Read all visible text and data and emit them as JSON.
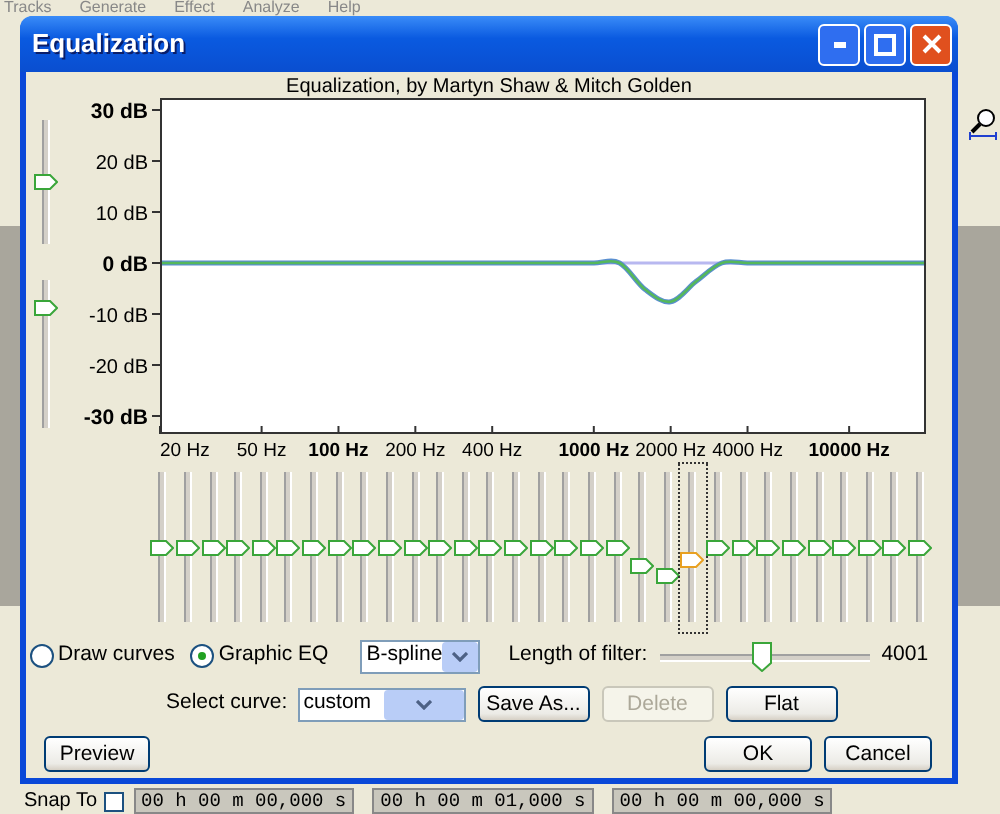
{
  "background_app": {
    "menu": [
      "Tracks",
      "Generate",
      "Effect",
      "Analyze",
      "Help"
    ],
    "snap_to": {
      "label": "Snap To",
      "checked": false
    },
    "time_fields": [
      "00 h 00 m 00,000 s",
      "00 h 00 m 01,000 s",
      "00 h 00 m 00,000 s"
    ]
  },
  "dialog": {
    "title": "Equalization",
    "header": "Equalization, by Martyn Shaw & Mitch Golden",
    "gain_sliders": [
      {
        "level": 0.5
      },
      {
        "level": 0.81
      }
    ],
    "graph": {
      "y_labels": [
        "30 dB",
        "20 dB",
        "10 dB",
        "0 dB",
        "-10 dB",
        "-20 dB",
        "-30 dB"
      ],
      "x_labels": [
        "20 Hz",
        "50 Hz",
        "100 Hz",
        "200 Hz",
        "400 Hz",
        "1000 Hz",
        "2000 Hz",
        "4000 Hz",
        "10000 Hz"
      ]
    },
    "bands": [
      {
        "level": 0.5,
        "selected": false
      },
      {
        "level": 0.5,
        "selected": false
      },
      {
        "level": 0.5,
        "selected": false
      },
      {
        "level": 0.5,
        "selected": false
      },
      {
        "level": 0.5,
        "selected": false
      },
      {
        "level": 0.5,
        "selected": false
      },
      {
        "level": 0.5,
        "selected": false
      },
      {
        "level": 0.5,
        "selected": false
      },
      {
        "level": 0.5,
        "selected": false
      },
      {
        "level": 0.5,
        "selected": false
      },
      {
        "level": 0.5,
        "selected": false
      },
      {
        "level": 0.5,
        "selected": false
      },
      {
        "level": 0.5,
        "selected": false
      },
      {
        "level": 0.5,
        "selected": false
      },
      {
        "level": 0.5,
        "selected": false
      },
      {
        "level": 0.5,
        "selected": false
      },
      {
        "level": 0.5,
        "selected": false
      },
      {
        "level": 0.5,
        "selected": false
      },
      {
        "level": 0.5,
        "selected": false
      },
      {
        "level": 0.37,
        "selected": false
      },
      {
        "level": 0.31,
        "selected": false
      },
      {
        "level": 0.41,
        "selected": true
      },
      {
        "level": 0.5,
        "selected": false
      },
      {
        "level": 0.5,
        "selected": false
      },
      {
        "level": 0.5,
        "selected": false
      },
      {
        "level": 0.5,
        "selected": false
      },
      {
        "level": 0.5,
        "selected": false
      },
      {
        "level": 0.5,
        "selected": false
      },
      {
        "level": 0.5,
        "selected": false
      },
      {
        "level": 0.5,
        "selected": false
      },
      {
        "level": 0.5,
        "selected": false
      }
    ],
    "mode_options": [
      {
        "label": "Draw curves",
        "selected": false
      },
      {
        "label": "Graphic EQ",
        "selected": true
      }
    ],
    "interpolation": "B-spline",
    "filter_length": {
      "label": "Length of filter:",
      "level": 0.49,
      "reading": "4001"
    },
    "curve": {
      "label": "Select curve:",
      "value": "custom"
    },
    "curve_buttons": [
      {
        "label": "Save As...",
        "disabled": false
      },
      {
        "label": "Delete",
        "disabled": true
      },
      {
        "label": "Flat",
        "disabled": false
      }
    ],
    "preview": "Preview",
    "buttons": [
      "OK",
      "Cancel"
    ]
  }
}
